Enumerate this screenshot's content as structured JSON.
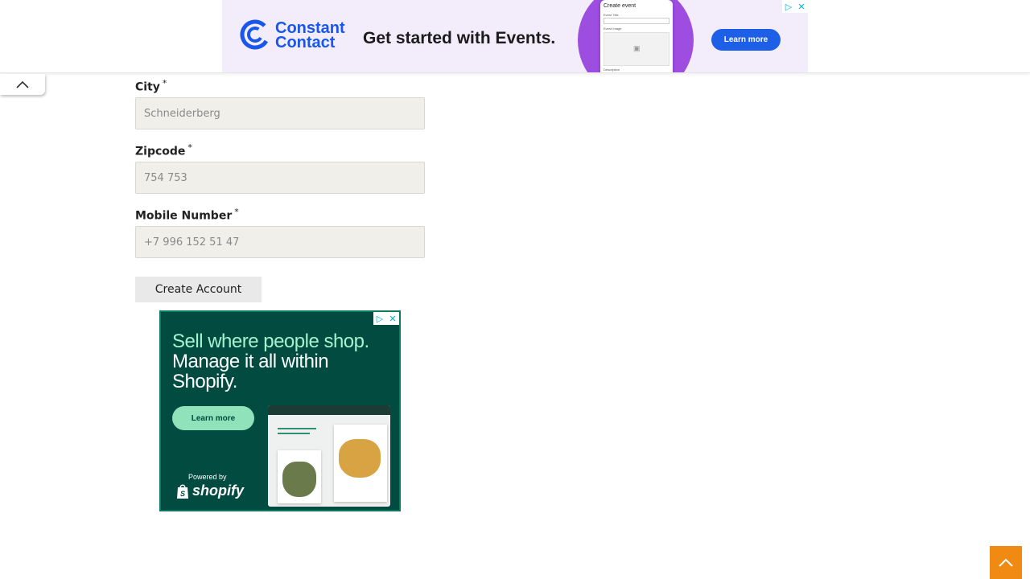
{
  "top_ad": {
    "brand": "Constant Contact",
    "headline": "Get started with Events.",
    "phone": {
      "title": "Create event",
      "event_title_label": "Event Title",
      "event_image_label": "Event Image",
      "description_label": "Description"
    },
    "cta": "Learn more",
    "brand_color": "#1856ed",
    "accent_color": "#9d4de0"
  },
  "form": {
    "city": {
      "label": "City",
      "required_mark": "*",
      "placeholder": "Schneiderberg"
    },
    "zipcode": {
      "label": "Zipcode",
      "required_mark": "*",
      "placeholder": "754 753"
    },
    "mobile": {
      "label": "Mobile Number",
      "required_mark": "*",
      "placeholder": "+7 996 152 51 47"
    },
    "submit_label": "Create Account"
  },
  "shop_ad": {
    "headline_highlight": "Sell where people shop.",
    "headline_rest": "Manage it all within Shopify.",
    "cta": "Learn more",
    "powered_by": "Powered by",
    "brand": "shopify",
    "background_color": "#024b41"
  },
  "icons": {
    "ad_info": "ad-info-icon",
    "ad_close": "close-icon",
    "collapse": "chevron-up-icon",
    "scroll_top": "chevron-up-icon"
  },
  "colors": {
    "scroll_top": "#f08a12"
  }
}
